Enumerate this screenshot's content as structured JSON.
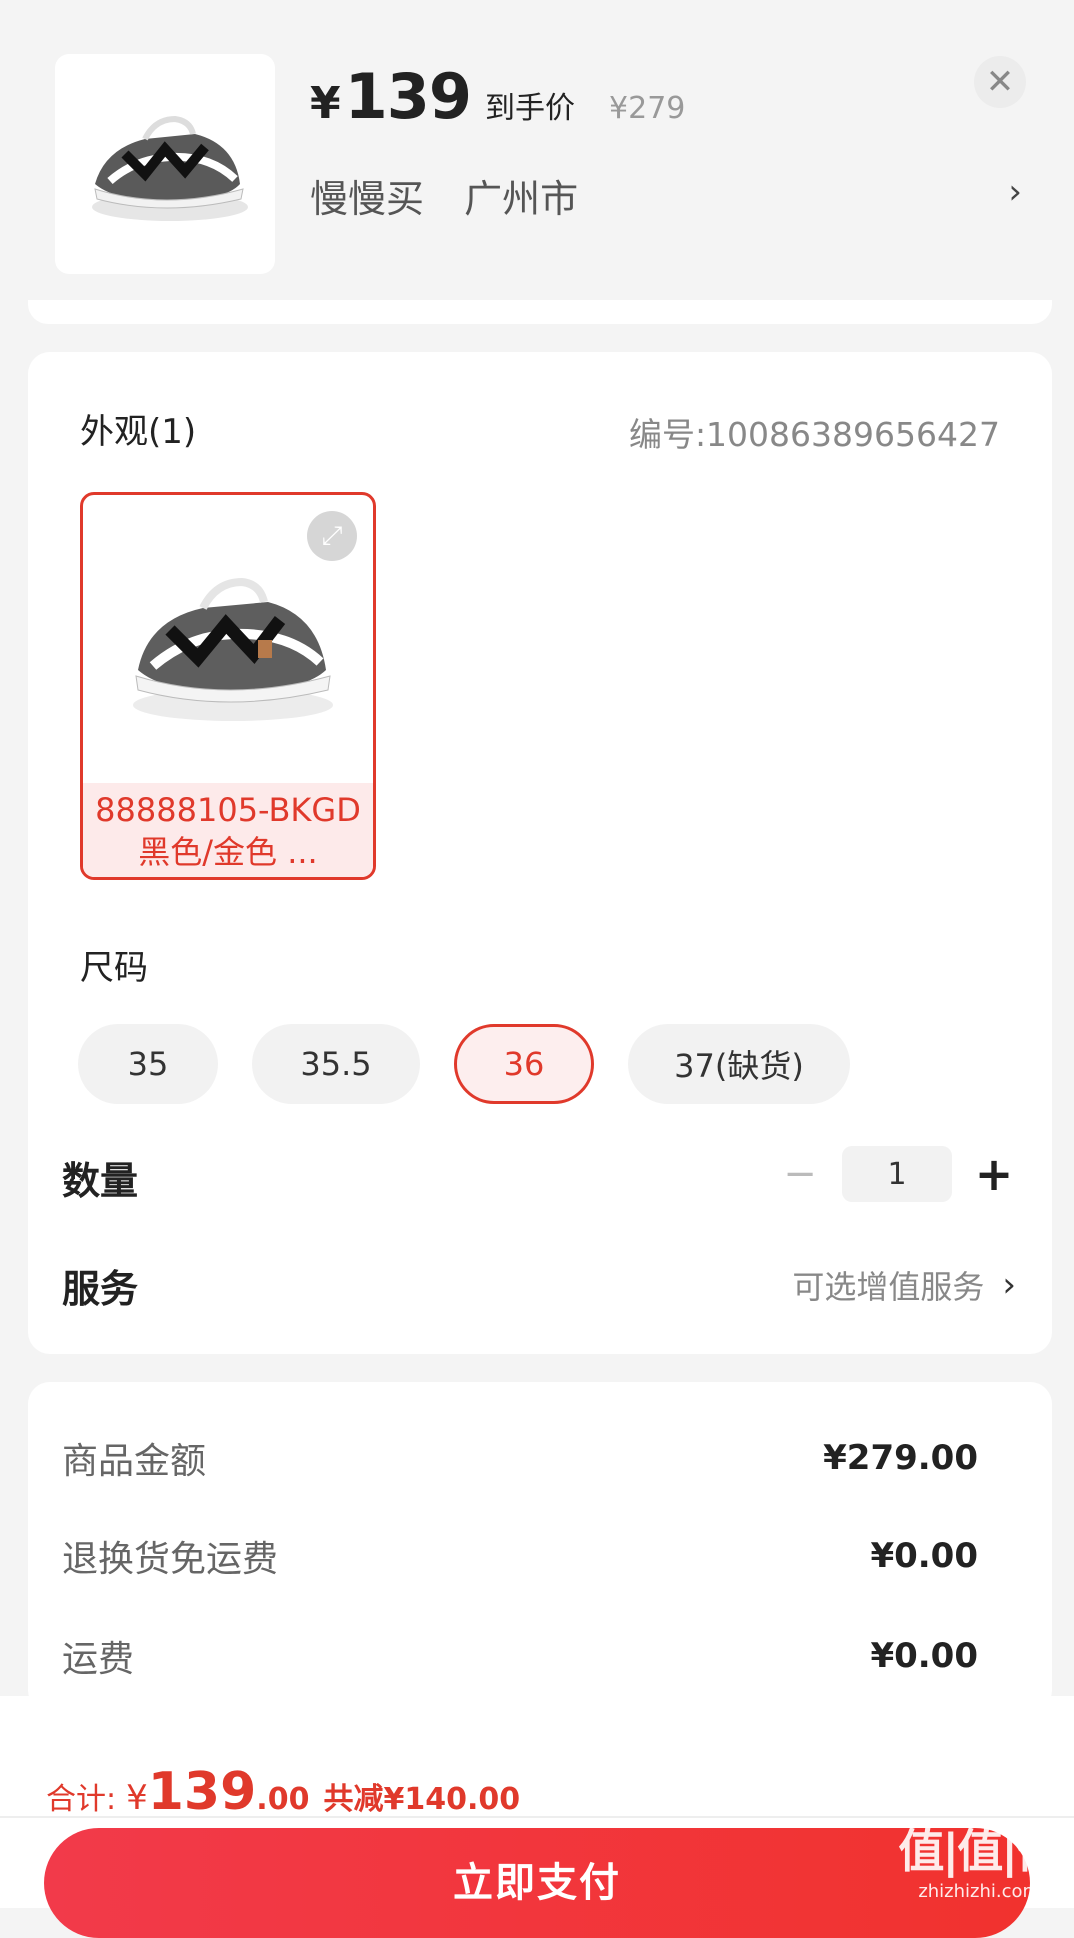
{
  "header": {
    "currency": "¥",
    "price": "139",
    "price_tag": "到手价",
    "original_price": "¥279",
    "seller": "慢慢买",
    "location": "广州市",
    "close_glyph": "✕",
    "chevron_glyph": "›"
  },
  "spec": {
    "appearance_title": "外观(1)",
    "sku_code": "编号:10086389656427",
    "variant_label": "88888105-BKGD 黑色/金色 ...",
    "size_title": "尺码",
    "sizes": [
      {
        "label": "35",
        "selected": false
      },
      {
        "label": "35.5",
        "selected": false
      },
      {
        "label": "36",
        "selected": true
      },
      {
        "label": "37(缺货)",
        "selected": false
      }
    ],
    "quantity_label": "数量",
    "quantity_value": "1",
    "minus_glyph": "−",
    "plus_glyph": "+",
    "service_label": "服务",
    "service_hint": "可选增值服务",
    "service_chevron": "›"
  },
  "fees": {
    "goods_amount_label": "商品金额",
    "goods_amount_value": "¥279.00",
    "return_shipping_label": "退换货免运费",
    "return_shipping_value": "¥0.00",
    "shipping_label": "运费",
    "shipping_value": "¥0.00"
  },
  "bottom": {
    "total_label": "合计:",
    "total_currency": "¥",
    "total_integer": "139",
    "total_decimal": ".00",
    "savings": "共减¥140.00",
    "pay_button": "立即支付",
    "watermark_main": "值|值|值",
    "watermark_sub": "zhizhizhi.com"
  },
  "colors": {
    "accent": "#e0392b",
    "pay_button": "#f23a4a"
  },
  "icons": {
    "close": "close-icon",
    "expand": "expand-icon",
    "chevron": "chevron-right-icon"
  }
}
